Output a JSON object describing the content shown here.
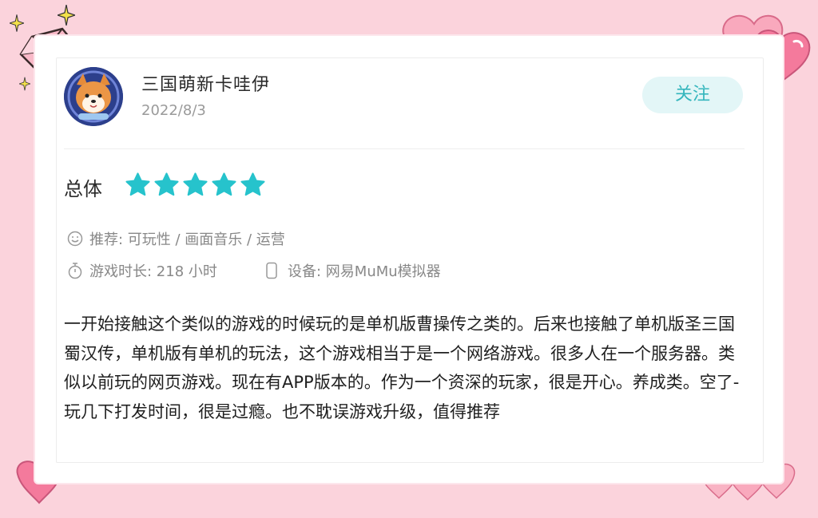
{
  "user": {
    "name": "三国萌新卡哇伊",
    "date": "2022/8/3",
    "follow_label": "关注"
  },
  "rating": {
    "label": "总体",
    "stars": 5,
    "max_stars": 5,
    "star_color": "#26c3cc"
  },
  "recommend": {
    "prefix": "推荐: ",
    "items": [
      "可玩性",
      "画面音乐",
      "运营"
    ],
    "text": "可玩性 / 画面音乐 / 运营"
  },
  "playtime": {
    "label": "游戏时长: ",
    "value": "218 小时"
  },
  "device": {
    "label": "设备: ",
    "value": "网易MuMu模拟器"
  },
  "review": {
    "text": "一开始接触这个类似的游戏的时候玩的是单机版曹操传之类的。后来也接触了单机版圣三国蜀汉传，单机版有单机的玩法，这个游戏相当于是一个网络游戏。很多人在一个服务器。类似以前玩的网页游戏。现在有APP版本的。作为一个资深的玩家，很是开心。养成类。空了-玩几下打发时间，很是过瘾。也不耽误游戏升级，值得推荐"
  },
  "colors": {
    "background": "#fbd3dc",
    "accent": "#35b6bd",
    "follow_bg": "#e3f6f7",
    "heart": "#f47a9c"
  },
  "icons": [
    "diamond-icon",
    "sparkle-icon",
    "heart-icon",
    "smile-icon",
    "stopwatch-icon",
    "phone-icon",
    "star-icon"
  ]
}
